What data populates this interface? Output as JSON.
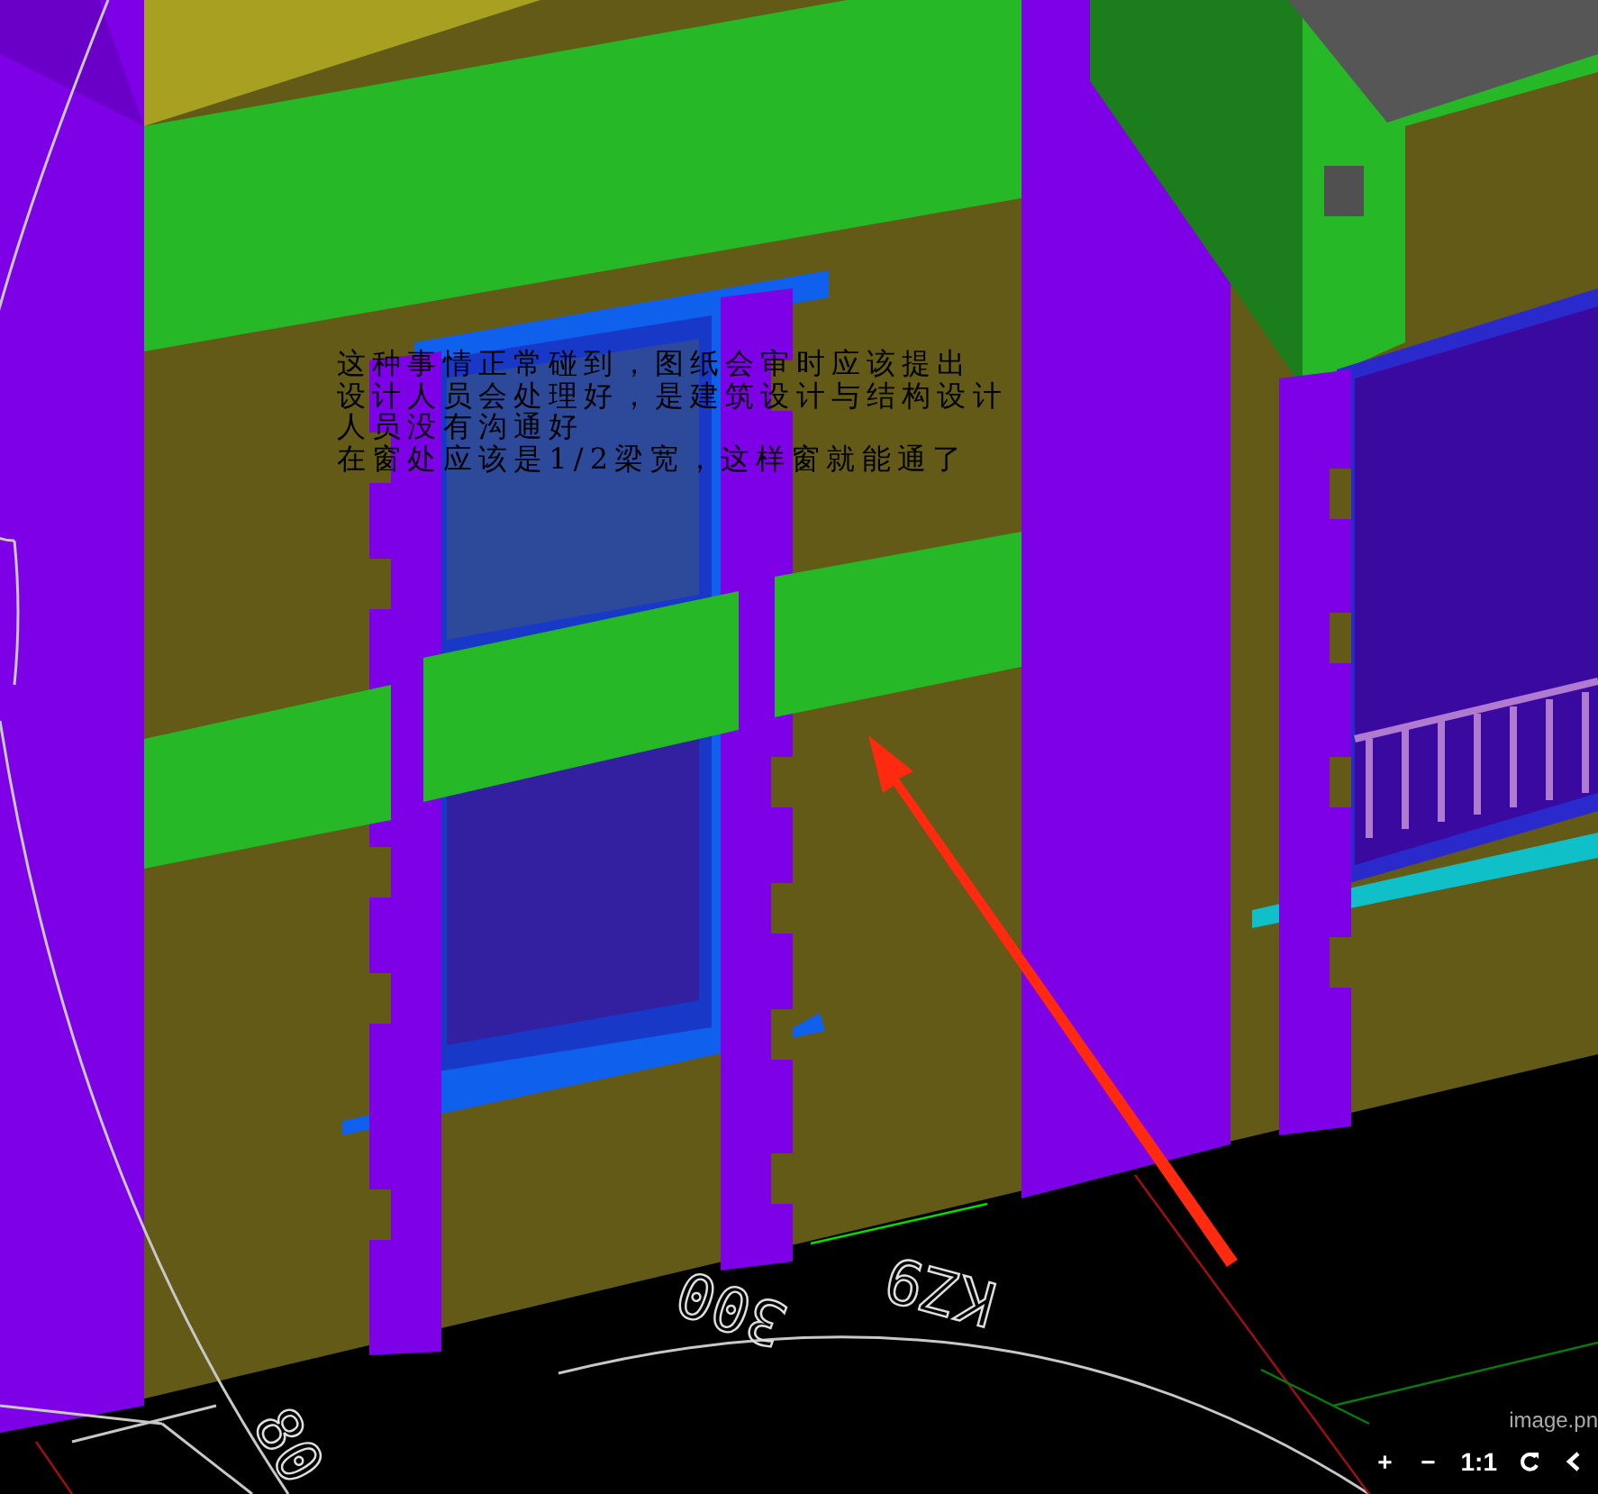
{
  "annotation": {
    "lines": [
      "这种事情正常碰到，图纸会审时应该提出",
      "设计人员会处理好，是建筑设计与结构设计",
      "人员没有沟通好",
      "在窗处应该是1/2梁宽，这样窗就能通了"
    ]
  },
  "cad_labels": [
    {
      "text": "300"
    },
    {
      "text": "KZ9"
    },
    {
      "text": "80"
    }
  ],
  "viewer": {
    "filename": "image.pn",
    "controls": [
      {
        "kind": "text",
        "label": "+"
      },
      {
        "kind": "text",
        "label": "−"
      },
      {
        "kind": "text",
        "label": "1:1"
      },
      {
        "kind": "rotate"
      },
      {
        "kind": "previous"
      }
    ]
  }
}
